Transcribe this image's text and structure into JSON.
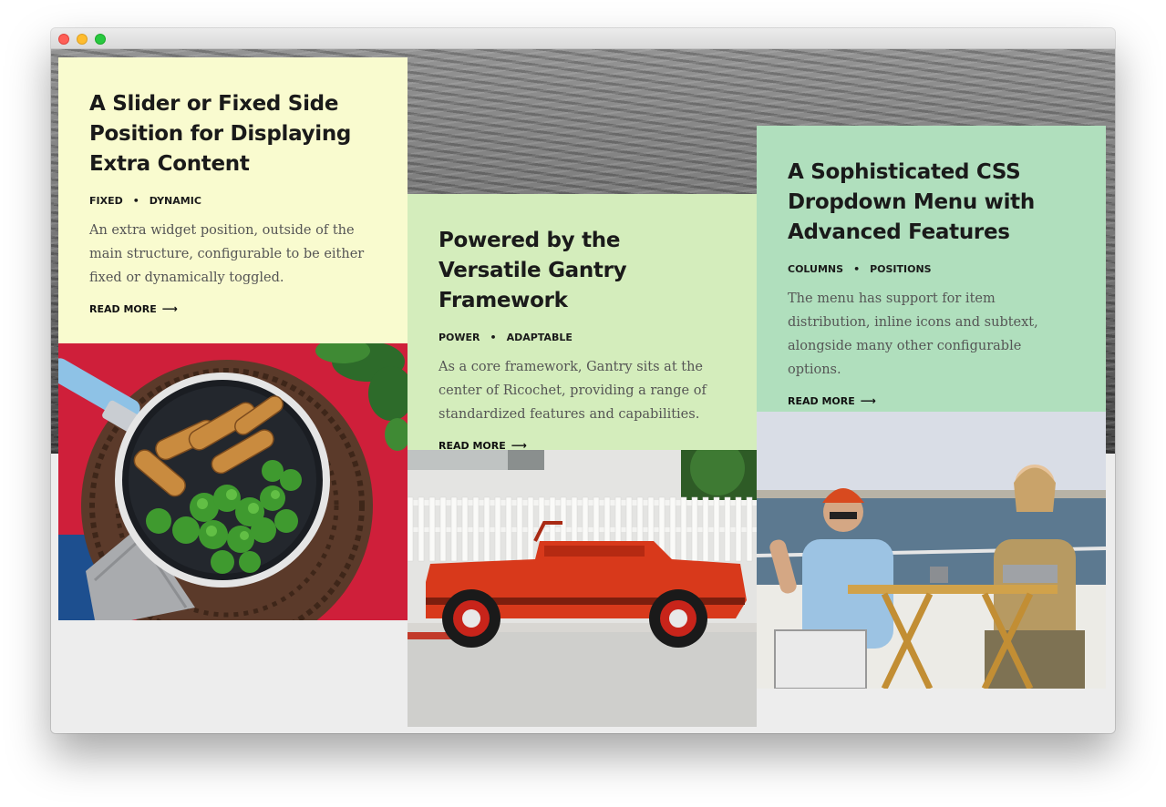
{
  "window": {
    "controls": {
      "close_color": "#ff5f57",
      "minimize_color": "#febc2e",
      "maximize_color": "#28c840"
    }
  },
  "cards": [
    {
      "title": "A Slider or Fixed Side Position for Displaying Extra Content",
      "tags": [
        "FIXED",
        "DYNAMIC"
      ],
      "description": "An extra widget position, outside of the main structure, configurable to be either fixed or dynamically toggled.",
      "read_more": "READ MORE",
      "background": "#f9fbcf"
    },
    {
      "title": "Powered by the Versatile Gantry Framework",
      "tags": [
        "POWER",
        "ADAPTABLE"
      ],
      "description": "As a core framework, Gantry sits at the center of Ricochet, providing a range of standardized features and capabilities.",
      "read_more": "READ MORE",
      "background": "#d4edbc"
    },
    {
      "title": "A Sophisticated CSS Dropdown Menu with Advanced Features",
      "tags": [
        "COLUMNS",
        "POSITIONS"
      ],
      "description": "The menu has support for item distribution, inline icons and subtext, alongside many other configurable options.",
      "read_more": "READ MORE",
      "background": "#b0dfbd"
    }
  ],
  "photos": [
    {
      "subject": "pan-of-chicken-and-broccoli"
    },
    {
      "subject": "red-vintage-car"
    },
    {
      "subject": "two-people-on-boat-deck"
    }
  ],
  "tag_separator": "•",
  "arrow_glyph": "⟶"
}
